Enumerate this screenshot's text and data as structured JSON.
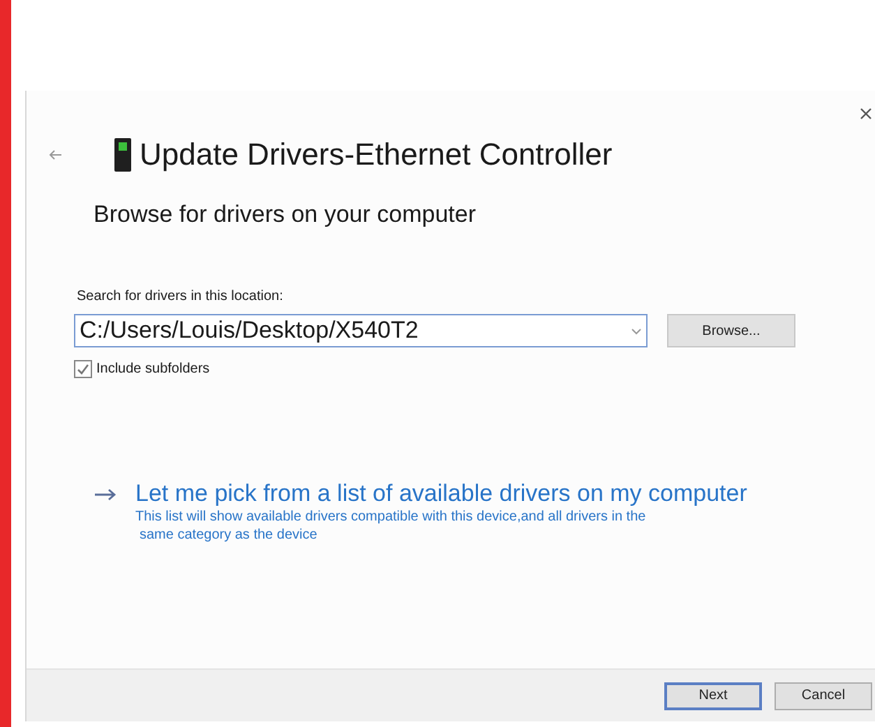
{
  "dialog": {
    "title": "Update Drivers-Ethernet Controller",
    "subtitle": "Browse for drivers on your computer",
    "search": {
      "label": "Search for drivers in this location:",
      "value": "C:/Users/Louis/Desktop/X540T2",
      "browse": "Browse..."
    },
    "include_subfolders": {
      "label": "Include subfolders",
      "checked": true
    },
    "pick_link": {
      "title": "Let me pick from a list of available drivers on my computer",
      "description_lines": [
        "This list will show available drivers compatible with this device,and all drivers in the",
        "same category as the device"
      ]
    },
    "buttons": [
      {
        "label": "Next",
        "default": true
      },
      {
        "label": "Cancel",
        "default": false
      }
    ]
  }
}
